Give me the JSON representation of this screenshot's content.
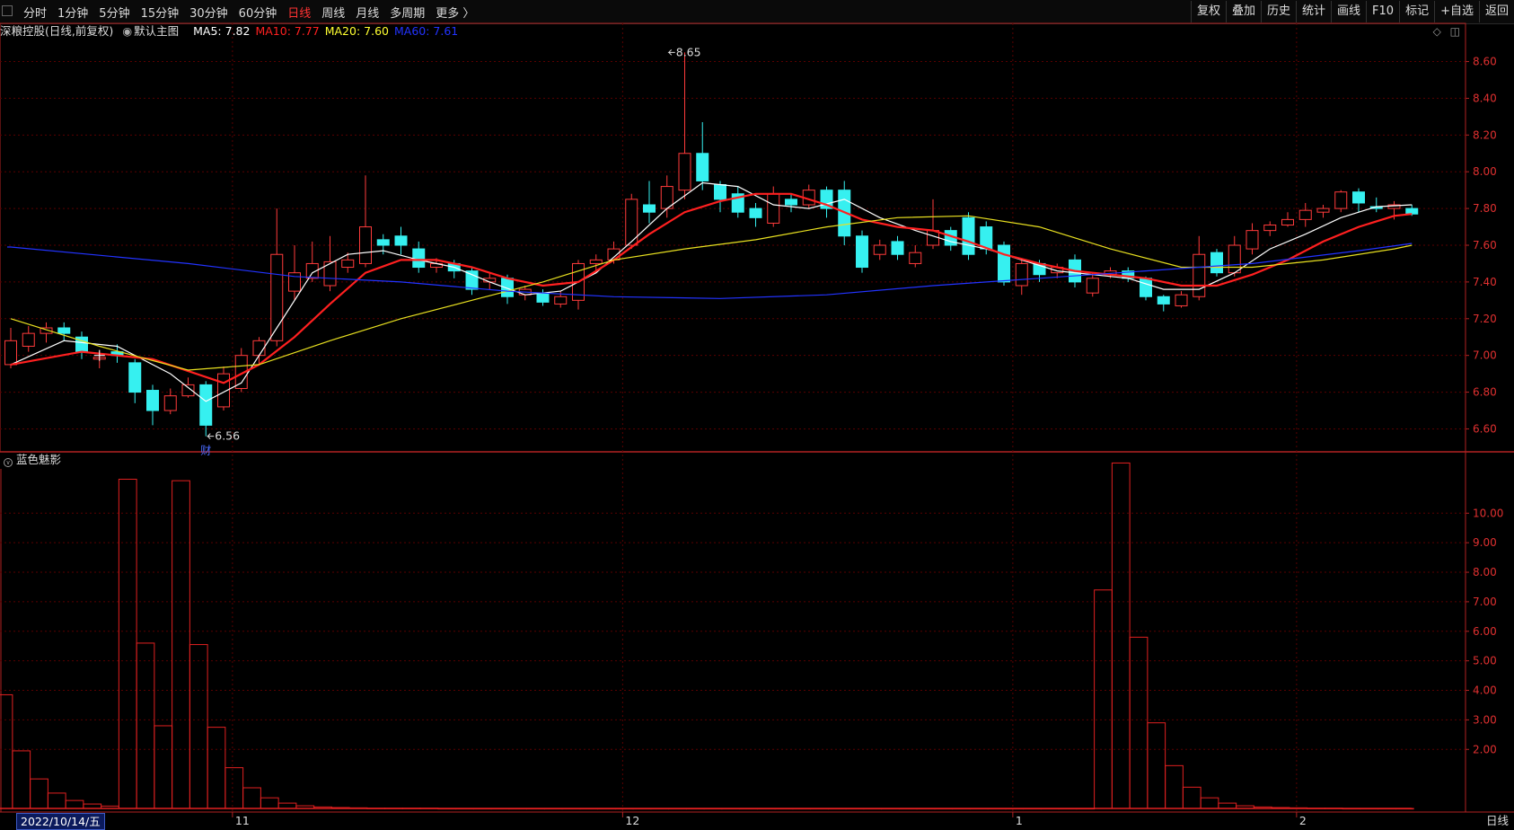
{
  "toolbar": {
    "periods": [
      "分时",
      "1分钟",
      "5分钟",
      "15分钟",
      "30分钟",
      "60分钟",
      "日线",
      "周线",
      "月线",
      "多周期",
      "更多 〉"
    ],
    "active_period": "日线",
    "tools": [
      "复权",
      "叠加",
      "历史",
      "统计",
      "画线",
      "F10",
      "标记",
      "+自选",
      "返回"
    ]
  },
  "info": {
    "stock": "深粮控股(日线,前复权)",
    "main_chart": "默认主图",
    "ma": [
      {
        "label": "MA5: 7.82",
        "color": "#ffffff"
      },
      {
        "label": "MA10: 7.77",
        "color": "#ff2020"
      },
      {
        "label": "MA20: 7.60",
        "color": "#ffff30"
      },
      {
        "label": "MA60: 7.61",
        "color": "#2233ff"
      }
    ]
  },
  "subchart": {
    "title": "蓝色魅影"
  },
  "footer": {
    "date": "2022/10/14/五",
    "period_label": "日线"
  },
  "colors": {
    "up": "#ff3b3b",
    "down": "#36f0f0",
    "grid": "#5a0000",
    "axis": "#b22222"
  },
  "chart_data": {
    "type": "candlestick",
    "price_axis": {
      "ticks": [
        "8.60",
        "8.40",
        "8.20",
        "8.00",
        "7.80",
        "7.60",
        "7.40",
        "7.20",
        "7.00",
        "6.80",
        "6.60"
      ],
      "ylim": [
        6.48,
        8.72
      ]
    },
    "annotations": [
      {
        "text": "8.65",
        "price": 8.65,
        "bar": 37
      },
      {
        "text": "6.56",
        "price": 6.56,
        "bar": 11,
        "note": "财"
      }
    ],
    "month_labels": [
      {
        "text": "11",
        "bar": 13
      },
      {
        "text": "12",
        "bar": 35
      },
      {
        "text": "1",
        "bar": 57
      },
      {
        "text": "2",
        "bar": 73
      }
    ],
    "candles": [
      [
        6.95,
        7.08,
        6.93,
        7.15
      ],
      [
        7.05,
        7.12,
        7.02,
        7.16
      ],
      [
        7.12,
        7.15,
        7.07,
        7.18
      ],
      [
        7.15,
        7.12,
        7.08,
        7.18
      ],
      [
        7.1,
        7.02,
        6.98,
        7.13
      ],
      [
        6.98,
        6.99,
        6.93,
        7.03
      ],
      [
        7.02,
        7.0,
        6.96,
        7.06
      ],
      [
        6.96,
        6.8,
        6.74,
        6.98
      ],
      [
        6.81,
        6.7,
        6.62,
        6.84
      ],
      [
        6.7,
        6.78,
        6.68,
        6.82
      ],
      [
        6.78,
        6.84,
        6.77,
        6.88
      ],
      [
        6.84,
        6.62,
        6.56,
        6.86
      ],
      [
        6.72,
        6.9,
        6.7,
        6.94
      ],
      [
        6.82,
        7.0,
        6.8,
        7.04
      ],
      [
        7.0,
        7.08,
        6.95,
        7.1
      ],
      [
        7.08,
        7.55,
        7.05,
        7.8
      ],
      [
        7.35,
        7.45,
        7.3,
        7.6
      ],
      [
        7.42,
        7.5,
        7.4,
        7.62
      ],
      [
        7.38,
        7.51,
        7.35,
        7.65
      ],
      [
        7.48,
        7.52,
        7.45,
        7.56
      ],
      [
        7.5,
        7.7,
        7.48,
        7.98
      ],
      [
        7.63,
        7.6,
        7.55,
        7.66
      ],
      [
        7.65,
        7.6,
        7.55,
        7.7
      ],
      [
        7.58,
        7.48,
        7.45,
        7.62
      ],
      [
        7.48,
        7.5,
        7.45,
        7.53
      ],
      [
        7.5,
        7.46,
        7.42,
        7.52
      ],
      [
        7.46,
        7.36,
        7.33,
        7.48
      ],
      [
        7.4,
        7.42,
        7.36,
        7.45
      ],
      [
        7.42,
        7.32,
        7.28,
        7.44
      ],
      [
        7.33,
        7.36,
        7.3,
        7.38
      ],
      [
        7.34,
        7.29,
        7.27,
        7.36
      ],
      [
        7.28,
        7.32,
        7.26,
        7.35
      ],
      [
        7.3,
        7.5,
        7.25,
        7.52
      ],
      [
        7.5,
        7.52,
        7.45,
        7.55
      ],
      [
        7.52,
        7.58,
        7.5,
        7.62
      ],
      [
        7.6,
        7.85,
        7.58,
        7.88
      ],
      [
        7.82,
        7.78,
        7.72,
        7.95
      ],
      [
        7.8,
        7.92,
        7.75,
        7.98
      ],
      [
        7.9,
        8.1,
        7.85,
        8.65
      ],
      [
        8.1,
        7.95,
        7.9,
        8.27
      ],
      [
        7.93,
        7.85,
        7.78,
        7.95
      ],
      [
        7.88,
        7.78,
        7.75,
        7.92
      ],
      [
        7.8,
        7.75,
        7.7,
        7.83
      ],
      [
        7.72,
        7.88,
        7.7,
        7.92
      ],
      [
        7.85,
        7.82,
        7.78,
        7.88
      ],
      [
        7.82,
        7.9,
        7.8,
        7.93
      ],
      [
        7.9,
        7.8,
        7.75,
        7.92
      ],
      [
        7.9,
        7.65,
        7.6,
        7.95
      ],
      [
        7.65,
        7.48,
        7.45,
        7.68
      ],
      [
        7.55,
        7.6,
        7.52,
        7.63
      ],
      [
        7.62,
        7.55,
        7.52,
        7.65
      ],
      [
        7.5,
        7.56,
        7.48,
        7.6
      ],
      [
        7.6,
        7.68,
        7.58,
        7.85
      ],
      [
        7.68,
        7.6,
        7.57,
        7.7
      ],
      [
        7.75,
        7.55,
        7.52,
        7.78
      ],
      [
        7.7,
        7.58,
        7.55,
        7.73
      ],
      [
        7.6,
        7.4,
        7.38,
        7.62
      ],
      [
        7.38,
        7.5,
        7.33,
        7.53
      ],
      [
        7.5,
        7.44,
        7.4,
        7.52
      ],
      [
        7.45,
        7.48,
        7.42,
        7.5
      ],
      [
        7.52,
        7.4,
        7.37,
        7.55
      ],
      [
        7.34,
        7.42,
        7.32,
        7.45
      ],
      [
        7.44,
        7.46,
        7.42,
        7.48
      ],
      [
        7.46,
        7.42,
        7.4,
        7.48
      ],
      [
        7.42,
        7.32,
        7.3,
        7.43
      ],
      [
        7.32,
        7.28,
        7.24,
        7.33
      ],
      [
        7.27,
        7.33,
        7.26,
        7.35
      ],
      [
        7.32,
        7.55,
        7.3,
        7.65
      ],
      [
        7.56,
        7.45,
        7.43,
        7.58
      ],
      [
        7.45,
        7.6,
        7.43,
        7.65
      ],
      [
        7.58,
        7.68,
        7.55,
        7.72
      ],
      [
        7.68,
        7.71,
        7.65,
        7.73
      ],
      [
        7.71,
        7.74,
        7.7,
        7.78
      ],
      [
        7.74,
        7.79,
        7.7,
        7.83
      ],
      [
        7.78,
        7.8,
        7.75,
        7.82
      ],
      [
        7.8,
        7.89,
        7.78,
        7.9
      ],
      [
        7.89,
        7.83,
        7.78,
        7.91
      ],
      [
        7.81,
        7.8,
        7.78,
        7.86
      ],
      [
        7.8,
        7.82,
        7.74,
        7.84
      ],
      [
        7.8,
        7.77,
        7.76,
        7.82
      ]
    ],
    "ma_lines": {
      "MA5": {
        "x": [
          0,
          3,
          6,
          9,
          11,
          13,
          15,
          17,
          19,
          21,
          23,
          25,
          27,
          29,
          31,
          33,
          35,
          37,
          39,
          41,
          43,
          45,
          47,
          49,
          51,
          53,
          55,
          57,
          59,
          61,
          63,
          65,
          67,
          69,
          71,
          73,
          75,
          77,
          79
        ],
        "y": [
          6.95,
          7.08,
          7.05,
          6.9,
          6.75,
          6.85,
          7.15,
          7.45,
          7.55,
          7.57,
          7.52,
          7.48,
          7.4,
          7.33,
          7.35,
          7.45,
          7.62,
          7.8,
          7.94,
          7.92,
          7.82,
          7.8,
          7.85,
          7.75,
          7.68,
          7.62,
          7.58,
          7.52,
          7.46,
          7.44,
          7.42,
          7.36,
          7.36,
          7.45,
          7.58,
          7.66,
          7.75,
          7.81,
          7.82
        ]
      },
      "MA10": {
        "x": [
          0,
          4,
          8,
          12,
          14,
          16,
          18,
          20,
          22,
          24,
          26,
          28,
          30,
          32,
          34,
          36,
          38,
          40,
          42,
          44,
          46,
          48,
          50,
          52,
          54,
          56,
          58,
          60,
          62,
          64,
          66,
          68,
          70,
          72,
          74,
          76,
          78,
          79
        ],
        "y": [
          6.95,
          7.02,
          6.98,
          6.85,
          6.95,
          7.1,
          7.28,
          7.45,
          7.52,
          7.52,
          7.48,
          7.42,
          7.38,
          7.4,
          7.52,
          7.66,
          7.78,
          7.84,
          7.88,
          7.88,
          7.82,
          7.74,
          7.7,
          7.68,
          7.62,
          7.55,
          7.5,
          7.46,
          7.44,
          7.42,
          7.38,
          7.38,
          7.44,
          7.52,
          7.62,
          7.7,
          7.76,
          7.77
        ]
      },
      "MA20": {
        "x": [
          0,
          5,
          10,
          14,
          18,
          22,
          26,
          30,
          34,
          38,
          42,
          46,
          50,
          54,
          58,
          62,
          66,
          70,
          74,
          78,
          79
        ],
        "y": [
          7.2,
          7.05,
          6.92,
          6.95,
          7.08,
          7.2,
          7.3,
          7.4,
          7.52,
          7.58,
          7.63,
          7.7,
          7.75,
          7.76,
          7.7,
          7.58,
          7.48,
          7.48,
          7.52,
          7.58,
          7.6
        ]
      },
      "MA60": {
        "x": [
          0,
          10,
          16,
          22,
          28,
          34,
          40,
          46,
          52,
          58,
          64,
          70,
          76,
          79
        ],
        "y": [
          7.59,
          7.5,
          7.43,
          7.4,
          7.35,
          7.32,
          7.31,
          7.33,
          7.38,
          7.42,
          7.46,
          7.5,
          7.57,
          7.61
        ]
      }
    },
    "sub_axis": {
      "ticks": [
        "10.00",
        "9.00",
        "8.00",
        "7.00",
        "6.00",
        "5.00",
        "4.00",
        "3.00",
        "2.00"
      ],
      "ylim": [
        0,
        11.5
      ]
    },
    "sub_bars": [
      3.85,
      1.95,
      1.0,
      0.52,
      0.27,
      0.15,
      0.08,
      11.15,
      5.6,
      2.8,
      11.1,
      5.55,
      2.75,
      1.38,
      0.7,
      0.36,
      0.18,
      0.09,
      0.05,
      0.03,
      0.02,
      0.01,
      0.01,
      0.01,
      0.01,
      0.0,
      0.0,
      0.0,
      0.0,
      0.0,
      0.0,
      0.0,
      0.0,
      0.0,
      0.0,
      0.0,
      0.0,
      0.0,
      0.0,
      0.0,
      0.0,
      0.0,
      0.0,
      0.0,
      0.0,
      0.0,
      0.0,
      0.0,
      0.0,
      0.0,
      0.0,
      0.0,
      0.0,
      0.0,
      0.0,
      0.0,
      0.0,
      0.0,
      0.0,
      0.0,
      0.0,
      0.0,
      7.4,
      11.7,
      5.8,
      2.9,
      1.45,
      0.72,
      0.36,
      0.18,
      0.09,
      0.05,
      0.03,
      0.02,
      0.01,
      0.01,
      0.0,
      0.0,
      0.0,
      0.0
    ]
  }
}
